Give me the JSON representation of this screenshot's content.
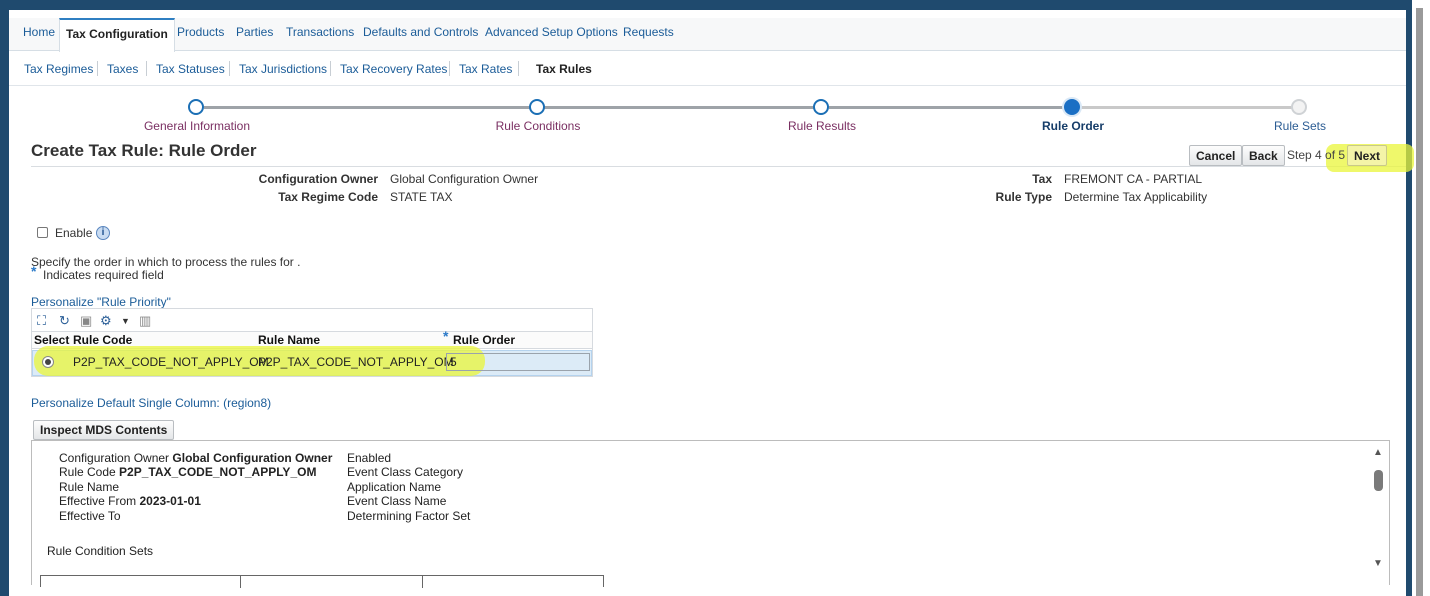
{
  "top_tabs": [
    "Home",
    "Tax Configuration",
    "Products",
    "Parties",
    "Transactions",
    "Defaults and Controls",
    "Advanced Setup Options",
    "Requests"
  ],
  "sub_tabs": [
    "Tax Regimes",
    "Taxes",
    "Tax Statuses",
    "Tax Jurisdictions",
    "Tax Recovery Rates",
    "Tax Rates",
    "Tax Rules"
  ],
  "train": {
    "steps": [
      "General Information",
      "Rule Conditions",
      "Rule Results",
      "Rule Order",
      "Rule Sets"
    ],
    "current_step": 4
  },
  "page_title": "Create Tax Rule: Rule Order",
  "actions": {
    "cancel": "Cancel",
    "back": "Back",
    "step_text": "Step 4 of 5",
    "next": "Next"
  },
  "header_fields": {
    "config_owner_label": "Configuration Owner",
    "config_owner_value": "Global Configuration Owner",
    "regime_label": "Tax Regime Code",
    "regime_value": "STATE TAX",
    "tax_label": "Tax",
    "tax_value": "FREMONT CA - PARTIAL",
    "rule_type_label": "Rule Type",
    "rule_type_value": "Determine Tax Applicability"
  },
  "enable_label": "Enable",
  "instructions": "Specify the order in which to process the rules for .",
  "required_note": "Indicates required field",
  "personalize_rule_priority": "Personalize \"Rule Priority\"",
  "table": {
    "headers": [
      "Select",
      "Rule Code",
      "Rule Name",
      "Rule Order"
    ],
    "rows": [
      {
        "rule_code": "P2P_TAX_CODE_NOT_APPLY_OM",
        "rule_name": "P2P_TAX_CODE_NOT_APPLY_OM",
        "rule_order": "5"
      }
    ]
  },
  "personalize_default": "Personalize Default Single Column: (region8)",
  "inspect_button": "Inspect MDS Contents",
  "mds": {
    "config_owner_label": "Configuration Owner",
    "config_owner_value": "Global Configuration Owner",
    "rule_code_label": "Rule Code",
    "rule_code_value": "P2P_TAX_CODE_NOT_APPLY_OM",
    "rule_name_label": "Rule Name",
    "effective_from_label": "Effective From",
    "effective_from_value": "2023-01-01",
    "effective_to_label": "Effective To",
    "right_labels": [
      "Enabled",
      "Event Class Category",
      "Application Name",
      "Event Class Name",
      "Determining Factor Set"
    ],
    "rule_condition_sets": "Rule Condition Sets"
  },
  "icons": {
    "toolbar": [
      "detach-icon",
      "refresh-icon",
      "export-icon",
      "settings-icon",
      "dropdown-icon",
      "columns-icon"
    ],
    "info": "info-icon"
  },
  "colors": {
    "highlight": "#e9f53a",
    "link": "#1b5c98",
    "current_step": "#1a6fc4"
  }
}
